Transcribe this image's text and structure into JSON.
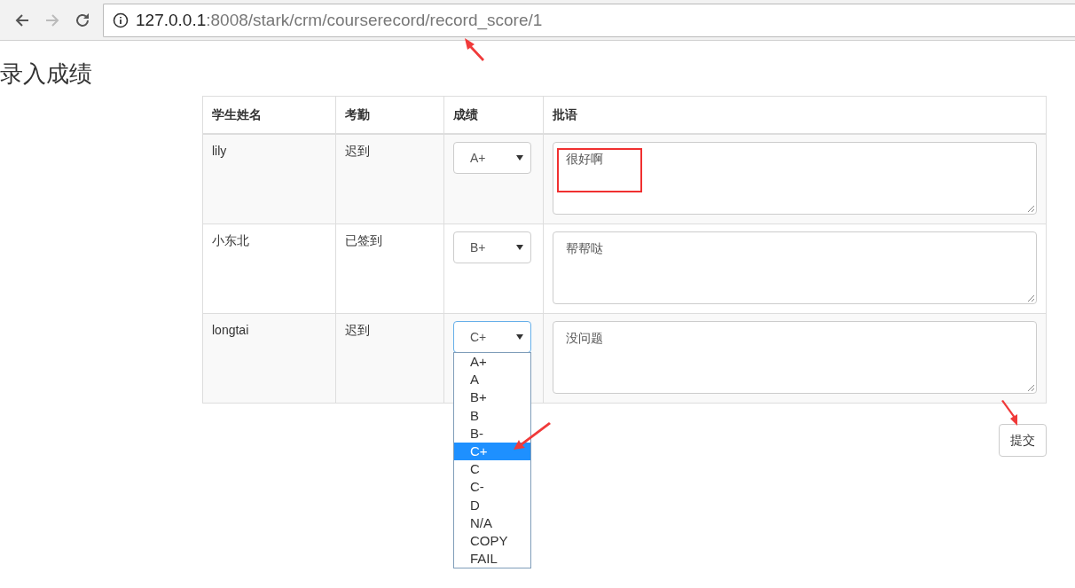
{
  "browser": {
    "url_host": "127.0.0.1",
    "url_path": ":8008/stark/crm/courserecord/record_score/1"
  },
  "heading": "录入成绩",
  "table": {
    "columns": [
      "学生姓名",
      "考勤",
      "成绩",
      "批语"
    ],
    "rows": [
      {
        "name": "lily",
        "attendance": "迟到",
        "grade": "A+",
        "comment": "很好啊",
        "open": false
      },
      {
        "name": "小东北",
        "attendance": "已签到",
        "grade": "B+",
        "comment": "帮帮哒",
        "open": false
      },
      {
        "name": "longtai",
        "attendance": "迟到",
        "grade": "C+",
        "comment": "没问题",
        "open": true,
        "options": [
          {
            "label": "A+",
            "selected": false
          },
          {
            "label": "A",
            "selected": false
          },
          {
            "label": "B+",
            "selected": false
          },
          {
            "label": "B",
            "selected": false
          },
          {
            "label": "B-",
            "selected": false
          },
          {
            "label": "C+",
            "selected": true
          },
          {
            "label": "C",
            "selected": false
          },
          {
            "label": "C-",
            "selected": false
          },
          {
            "label": "D",
            "selected": false
          },
          {
            "label": "N/A",
            "selected": false
          },
          {
            "label": "COPY",
            "selected": false
          },
          {
            "label": "FAIL",
            "selected": false
          }
        ]
      }
    ]
  },
  "submit_button": "提交"
}
